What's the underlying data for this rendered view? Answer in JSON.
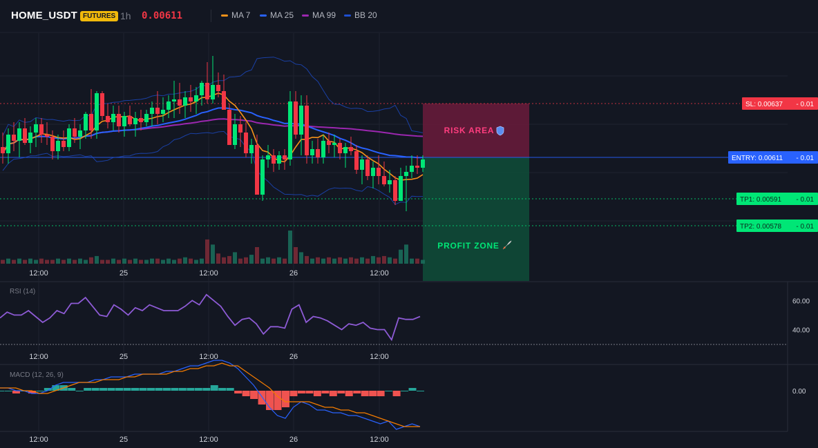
{
  "header": {
    "symbol": "HOME_USDT",
    "badge": "FUTURES",
    "timeframe": "1h",
    "last_price": "0.00611",
    "legend": [
      {
        "label": "MA 7",
        "color": "#f7931a"
      },
      {
        "label": "MA 25",
        "color": "#2962ff"
      },
      {
        "label": "MA 99",
        "color": "#9c27b0"
      },
      {
        "label": "BB 20",
        "color": "#1e4fd1"
      }
    ]
  },
  "colors": {
    "up": "#00e676",
    "down": "#f23645",
    "background": "#131722",
    "grid": "#1f2330",
    "ma7": "#f7931a",
    "ma25": "#2962ff",
    "ma99": "#9c27b0",
    "bb": "#1e4fd1",
    "rsi": "#8e5bd6",
    "macd": "#2962ff",
    "signal": "#f57c00",
    "macd_hist_pos": "#26a69a",
    "macd_hist_neg": "#ef5350"
  },
  "chart_data": {
    "type": "candlestick",
    "x_ticks": [
      "12:00",
      "25",
      "12:00",
      "26",
      "12:00"
    ],
    "price_range": [
      0.00552,
      0.00671
    ],
    "levels": [
      {
        "label": "SL: 0.00637",
        "value": 0.00637,
        "pnl": "- 0.01",
        "color": "#f23645"
      },
      {
        "label": "ENTRY: 0.00611",
        "value": 0.00611,
        "pnl": "- 0.01",
        "color": "#2962ff"
      },
      {
        "label": "TP1: 0.00591",
        "value": 0.00591,
        "pnl": "- 0.01",
        "color": "#00e676"
      },
      {
        "label": "TP2: 0.00578",
        "value": 0.00578,
        "pnl": "- 0.01",
        "color": "#00e676"
      }
    ],
    "zones": {
      "risk_label": "RISK AREA",
      "profit_label": "PROFIT ZONE"
    },
    "candles": [
      [
        0.00616,
        0.00623,
        0.00608,
        0.00613
      ],
      [
        0.00613,
        0.00625,
        0.00608,
        0.00622
      ],
      [
        0.00622,
        0.00628,
        0.00614,
        0.00619
      ],
      [
        0.00619,
        0.00628,
        0.00611,
        0.00625
      ],
      [
        0.00625,
        0.0063,
        0.00617,
        0.00618
      ],
      [
        0.00618,
        0.00626,
        0.00613,
        0.00623
      ],
      [
        0.00623,
        0.0063,
        0.00616,
        0.00627
      ],
      [
        0.00627,
        0.0063,
        0.00618,
        0.00622
      ],
      [
        0.00622,
        0.00628,
        0.00617,
        0.00621
      ],
      [
        0.00621,
        0.00624,
        0.0061,
        0.00614
      ],
      [
        0.00614,
        0.00622,
        0.0061,
        0.00619
      ],
      [
        0.00619,
        0.00624,
        0.00614,
        0.00616
      ],
      [
        0.00616,
        0.00627,
        0.00614,
        0.00625
      ],
      [
        0.00625,
        0.0063,
        0.00618,
        0.00621
      ],
      [
        0.00621,
        0.00627,
        0.00615,
        0.00624
      ],
      [
        0.00624,
        0.00633,
        0.0062,
        0.00632
      ],
      [
        0.00632,
        0.00644,
        0.0062,
        0.00624
      ],
      [
        0.00624,
        0.00643,
        0.0062,
        0.00642
      ],
      [
        0.00642,
        0.00643,
        0.00629,
        0.00631
      ],
      [
        0.00631,
        0.00637,
        0.00625,
        0.00628
      ],
      [
        0.00628,
        0.00636,
        0.00624,
        0.00632
      ],
      [
        0.00632,
        0.00636,
        0.00623,
        0.00626
      ],
      [
        0.00626,
        0.00633,
        0.00621,
        0.00631
      ],
      [
        0.00631,
        0.00636,
        0.00626,
        0.00627
      ],
      [
        0.00627,
        0.00633,
        0.00621,
        0.0063
      ],
      [
        0.0063,
        0.00634,
        0.00624,
        0.00628
      ],
      [
        0.00628,
        0.00634,
        0.00626,
        0.00632
      ],
      [
        0.00632,
        0.00638,
        0.00626,
        0.00635
      ],
      [
        0.00635,
        0.00643,
        0.00627,
        0.00632
      ],
      [
        0.00632,
        0.0064,
        0.00628,
        0.00634
      ],
      [
        0.00634,
        0.00641,
        0.0063,
        0.00638
      ],
      [
        0.00638,
        0.00648,
        0.0063,
        0.00639
      ],
      [
        0.00639,
        0.00647,
        0.00632,
        0.00636
      ],
      [
        0.00636,
        0.00643,
        0.0063,
        0.0064
      ],
      [
        0.0064,
        0.00646,
        0.00633,
        0.00638
      ],
      [
        0.00638,
        0.00645,
        0.00632,
        0.00641
      ],
      [
        0.00641,
        0.00648,
        0.00636,
        0.00647
      ],
      [
        0.00647,
        0.00657,
        0.00637,
        0.00639
      ],
      [
        0.00639,
        0.0066,
        0.00637,
        0.00646
      ],
      [
        0.00646,
        0.00652,
        0.0064,
        0.00643
      ],
      [
        0.00643,
        0.00651,
        0.00634,
        0.00634
      ],
      [
        0.00634,
        0.00637,
        0.00622,
        0.00617
      ],
      [
        0.00617,
        0.00632,
        0.00615,
        0.00627
      ],
      [
        0.00627,
        0.00631,
        0.00616,
        0.00623
      ],
      [
        0.00623,
        0.00628,
        0.00611,
        0.00613
      ],
      [
        0.00613,
        0.0062,
        0.00608,
        0.00617
      ],
      [
        0.00617,
        0.00622,
        0.00604,
        0.00593
      ],
      [
        0.00593,
        0.00612,
        0.0059,
        0.0061
      ],
      [
        0.0061,
        0.00617,
        0.00606,
        0.00612
      ],
      [
        0.00612,
        0.00615,
        0.00604,
        0.00608
      ],
      [
        0.00608,
        0.00614,
        0.00605,
        0.00612
      ],
      [
        0.00612,
        0.00615,
        0.00605,
        0.0061
      ],
      [
        0.0061,
        0.00643,
        0.00607,
        0.00638
      ],
      [
        0.00638,
        0.00643,
        0.0062,
        0.00622
      ],
      [
        0.00622,
        0.00641,
        0.00612,
        0.00636
      ],
      [
        0.00636,
        0.00641,
        0.00608,
        0.00612
      ],
      [
        0.00612,
        0.00619,
        0.00608,
        0.00615
      ],
      [
        0.00615,
        0.0062,
        0.00608,
        0.00611
      ],
      [
        0.00611,
        0.00622,
        0.00608,
        0.00619
      ],
      [
        0.00619,
        0.00623,
        0.00613,
        0.00617
      ],
      [
        0.00617,
        0.00622,
        0.00611,
        0.00618
      ],
      [
        0.00618,
        0.0062,
        0.0061,
        0.00613
      ],
      [
        0.00613,
        0.00618,
        0.00606,
        0.00616
      ],
      [
        0.00616,
        0.00621,
        0.00612,
        0.00614
      ],
      [
        0.00614,
        0.00617,
        0.00603,
        0.00605
      ],
      [
        0.00605,
        0.00612,
        0.00598,
        0.0061
      ],
      [
        0.0061,
        0.00612,
        0.006,
        0.00602
      ],
      [
        0.00602,
        0.00609,
        0.00596,
        0.00606
      ],
      [
        0.00606,
        0.00612,
        0.00598,
        0.00602
      ],
      [
        0.00602,
        0.00609,
        0.00597,
        0.00598
      ],
      [
        0.00598,
        0.00605,
        0.00594,
        0.006
      ],
      [
        0.006,
        0.00602,
        0.00588,
        0.0059
      ],
      [
        0.0059,
        0.00606,
        0.0059,
        0.00602
      ],
      [
        0.00602,
        0.00607,
        0.00585,
        0.00604
      ],
      [
        0.00604,
        0.00612,
        0.00601,
        0.00607
      ],
      [
        0.00607,
        0.00612,
        0.00603,
        0.00606
      ],
      [
        0.00606,
        0.00612,
        0.00604,
        0.0061
      ]
    ],
    "volume": [
      3,
      4,
      3,
      4,
      3,
      4,
      3,
      4,
      3,
      3,
      4,
      3,
      4,
      3,
      4,
      3,
      5,
      6,
      3,
      3,
      4,
      3,
      4,
      3,
      4,
      3,
      3,
      4,
      4,
      3,
      4,
      3,
      4,
      5,
      4,
      3,
      4,
      19,
      15,
      8,
      5,
      6,
      9,
      4,
      5,
      7,
      13,
      4,
      5,
      4,
      5,
      4,
      26,
      13,
      9,
      6,
      4,
      5,
      4,
      5,
      4,
      5,
      4,
      5,
      4,
      5,
      4,
      6,
      5,
      6,
      5,
      4,
      11,
      15,
      4,
      4,
      3
    ],
    "rsi": {
      "label": "RSI (14)",
      "ylim": [
        27,
        71
      ],
      "ticks": [
        60,
        40
      ],
      "tick_labels": [
        "60.00",
        "40.00"
      ],
      "values": [
        48,
        52,
        50,
        50,
        53,
        49,
        45,
        48,
        53,
        51,
        58,
        58,
        62,
        56,
        50,
        49,
        57,
        54,
        50,
        55,
        53,
        57,
        55,
        53,
        53,
        53,
        56,
        60,
        57,
        64,
        60,
        56,
        49,
        43,
        47,
        48,
        44,
        37,
        42,
        42,
        41,
        54,
        57,
        45,
        49,
        48,
        46,
        43,
        40,
        44,
        43,
        45,
        41,
        40,
        40,
        33,
        48,
        47,
        47,
        49
      ]
    },
    "macd": {
      "label": "MACD (12, 26, 9)",
      "ylim": [
        -0.00019,
        0.00014
      ],
      "tick_labels": [
        "0.00"
      ],
      "macd_values": [
        1e-05,
        1e-05,
        0.0,
        0.0,
        -1e-05,
        -1e-05,
        0.0,
        2e-05,
        3e-05,
        3e-05,
        3e-05,
        3e-05,
        4e-05,
        4e-05,
        5e-05,
        5e-05,
        5e-05,
        6e-05,
        6e-05,
        6e-05,
        6e-05,
        7e-05,
        7e-05,
        8e-05,
        9e-05,
        9e-05,
        0.0001,
        0.00011,
        0.00011,
        0.0001,
        8e-05,
        5e-05,
        2e-05,
        -2e-05,
        -6e-05,
        -9e-05,
        -0.0001,
        -6e-05,
        -4e-05,
        -5e-05,
        -7e-05,
        -7e-05,
        -8e-05,
        -8e-05,
        -9e-05,
        -9e-05,
        -0.0001,
        -0.00011,
        -0.00012,
        -0.00011,
        -0.00014,
        -0.00013,
        -0.00012,
        -0.00013
      ],
      "signal_values": [
        1e-05,
        1e-05,
        1e-05,
        0.0,
        0.0,
        -1e-05,
        -1e-05,
        0.0,
        1e-05,
        2e-05,
        3e-05,
        3e-05,
        3e-05,
        4e-05,
        4e-05,
        4e-05,
        5e-05,
        5e-05,
        6e-05,
        6e-05,
        6e-05,
        6e-05,
        7e-05,
        7e-05,
        8e-05,
        8e-05,
        9e-05,
        9e-05,
        0.0001,
        9e-05,
        9e-05,
        7e-05,
        5e-05,
        3e-05,
        1e-05,
        -2e-05,
        -4e-05,
        -4e-05,
        -4e-05,
        -4e-05,
        -5e-05,
        -6e-05,
        -6e-05,
        -7e-05,
        -7e-05,
        -8e-05,
        -8e-05,
        -9e-05,
        -0.0001,
        -0.00011,
        -0.00012,
        -0.00013,
        -0.00013,
        -0.00013
      ],
      "hist_values": [
        0.0,
        0.0,
        -1e-05,
        0.0,
        -1e-05,
        0.0,
        1e-05,
        2e-05,
        2e-05,
        1e-05,
        0.0,
        1e-05,
        1e-05,
        1e-05,
        1e-05,
        1e-05,
        1e-05,
        1e-05,
        1e-05,
        1e-05,
        1e-05,
        1e-05,
        1e-05,
        1e-05,
        1e-05,
        1e-05,
        1e-05,
        2e-05,
        1e-05,
        1e-05,
        -1e-05,
        -2e-05,
        -3e-05,
        -5e-05,
        -7e-05,
        -7e-05,
        -6e-05,
        -2e-05,
        -1e-05,
        -1e-05,
        -2e-05,
        -1e-05,
        -2e-05,
        -1e-05,
        -2e-05,
        -1e-05,
        -2e-05,
        -2e-05,
        -2e-05,
        0.0,
        -2e-05,
        0.0,
        1e-05,
        0.0
      ]
    }
  }
}
